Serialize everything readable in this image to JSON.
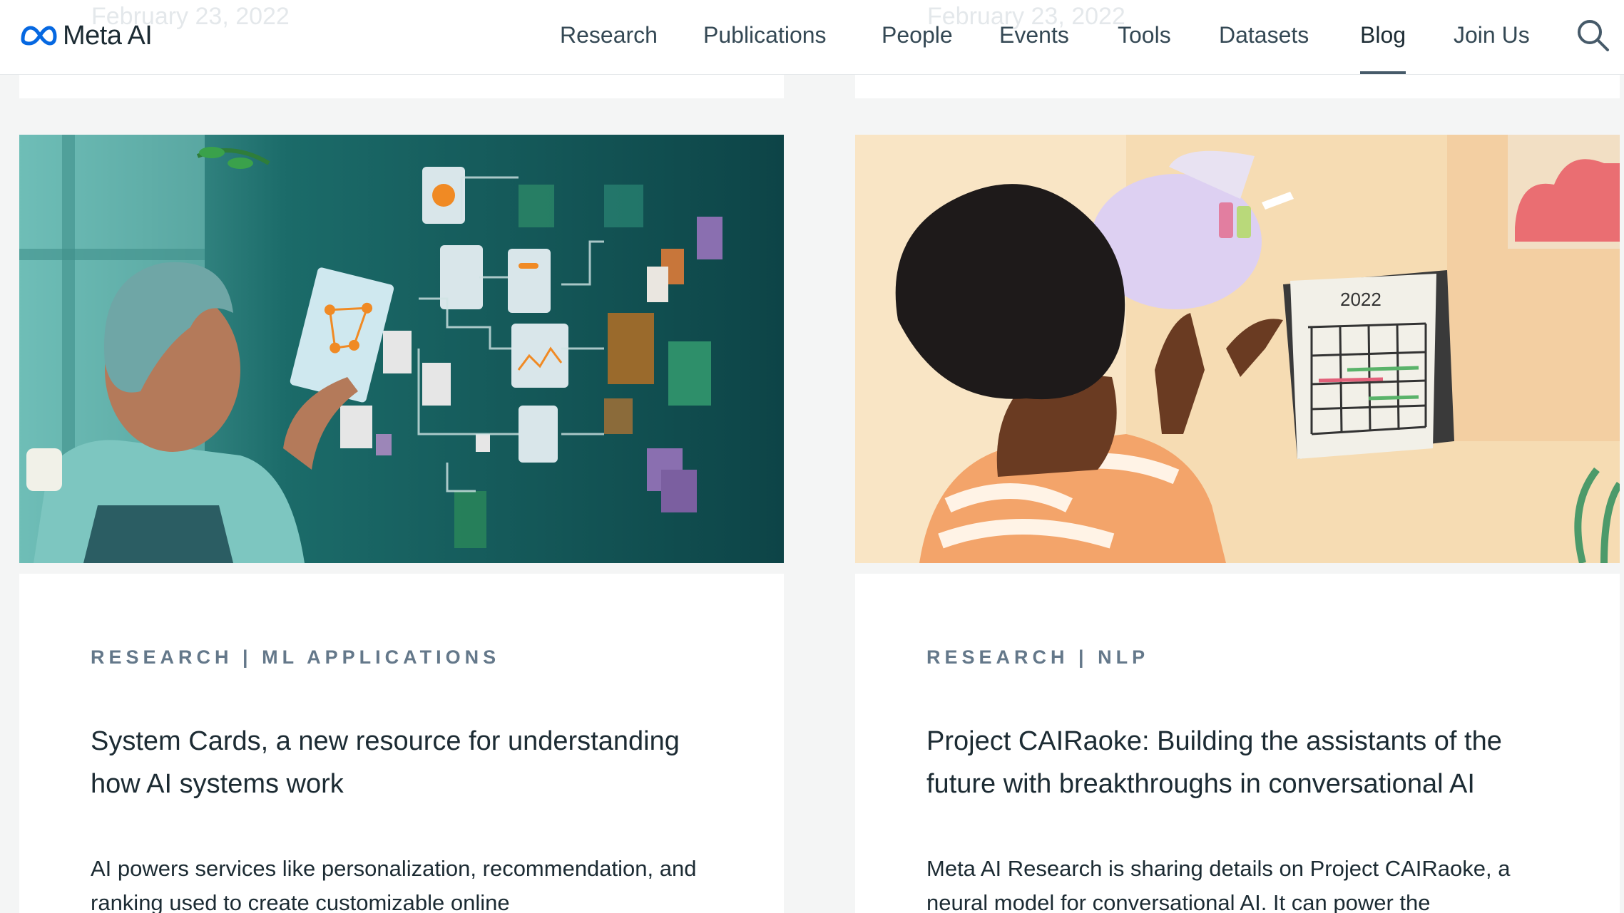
{
  "header": {
    "brand": "Meta AI",
    "nav": [
      {
        "label": "Research"
      },
      {
        "label": "Publications"
      },
      {
        "label": "People"
      },
      {
        "label": "Events"
      },
      {
        "label": "Tools"
      },
      {
        "label": "Datasets"
      },
      {
        "label": "Blog",
        "active": true
      },
      {
        "label": "Join Us"
      }
    ],
    "search_icon": "search-icon"
  },
  "previous_cards": [
    {
      "date": "February 23, 2022"
    },
    {
      "date": "February 23, 2022"
    }
  ],
  "cards": [
    {
      "category": "RESEARCH | ML APPLICATIONS",
      "title": "System Cards, a new resource for understanding how AI systems work",
      "excerpt": "AI powers services like personalization, recommendation, and ranking used to create customizable online"
    },
    {
      "category": "RESEARCH | NLP",
      "title": "Project CAIRaoke: Building the assistants of the future with breakthroughs in conversational AI",
      "excerpt": "Meta AI Research is sharing details on Project CAIRaoke, a neural model for conversational AI. It can power the"
    }
  ],
  "colors": {
    "brand_blue": "#0668e1",
    "text_dark": "#1c2b33",
    "category_gray": "#64788a",
    "page_bg": "#f4f5f5"
  }
}
